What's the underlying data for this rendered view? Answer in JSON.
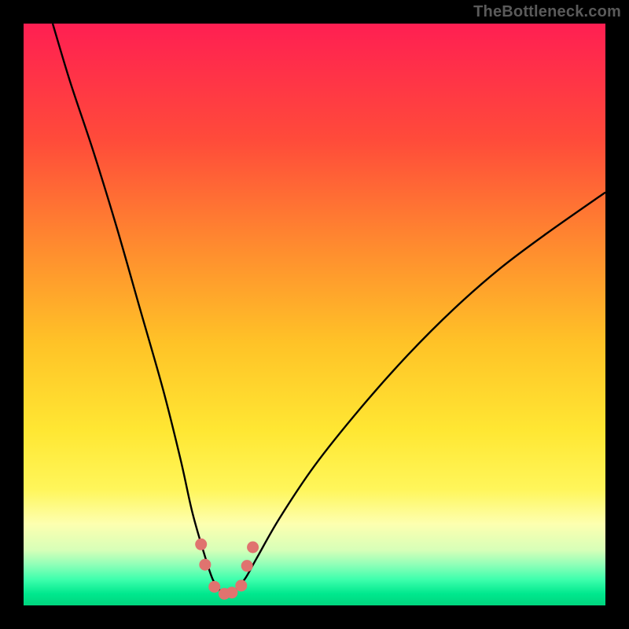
{
  "watermark": "TheBottleneck.com",
  "colors": {
    "frame": "#000000",
    "gradient_stops": [
      {
        "offset": 0.0,
        "color": "#ff1f52"
      },
      {
        "offset": 0.2,
        "color": "#ff4b3a"
      },
      {
        "offset": 0.38,
        "color": "#ff8a2f"
      },
      {
        "offset": 0.55,
        "color": "#ffc327"
      },
      {
        "offset": 0.7,
        "color": "#ffe733"
      },
      {
        "offset": 0.8,
        "color": "#fff65a"
      },
      {
        "offset": 0.86,
        "color": "#fdffb0"
      },
      {
        "offset": 0.905,
        "color": "#d7ffb8"
      },
      {
        "offset": 0.93,
        "color": "#8fffb8"
      },
      {
        "offset": 0.955,
        "color": "#3fffad"
      },
      {
        "offset": 0.98,
        "color": "#00e88e"
      },
      {
        "offset": 1.0,
        "color": "#00d57e"
      }
    ],
    "curve": "#000000",
    "dots": "#e0736f"
  },
  "chart_data": {
    "type": "line",
    "title": "",
    "xlabel": "",
    "ylabel": "",
    "xlim": [
      0,
      100
    ],
    "ylim": [
      0,
      100
    ],
    "series": [
      {
        "name": "bottleneck-curve",
        "x": [
          5,
          8,
          12,
          16,
          20,
          24,
          27,
          29,
          31,
          32.5,
          34,
          35,
          36,
          38,
          40,
          44,
          50,
          58,
          66,
          74,
          82,
          90,
          100
        ],
        "y": [
          100,
          90,
          78,
          65,
          51,
          37,
          25,
          16,
          9,
          4.5,
          2.3,
          2,
          2.3,
          4.5,
          8,
          15,
          24,
          34,
          43,
          51,
          58,
          64,
          71
        ]
      }
    ],
    "markers": {
      "name": "highlight-dots",
      "x": [
        30.5,
        31.2,
        32.8,
        34.5,
        35.8,
        37.4,
        38.4,
        39.4
      ],
      "y": [
        10.5,
        7.0,
        3.2,
        2.0,
        2.2,
        3.4,
        6.8,
        10.0
      ]
    }
  }
}
